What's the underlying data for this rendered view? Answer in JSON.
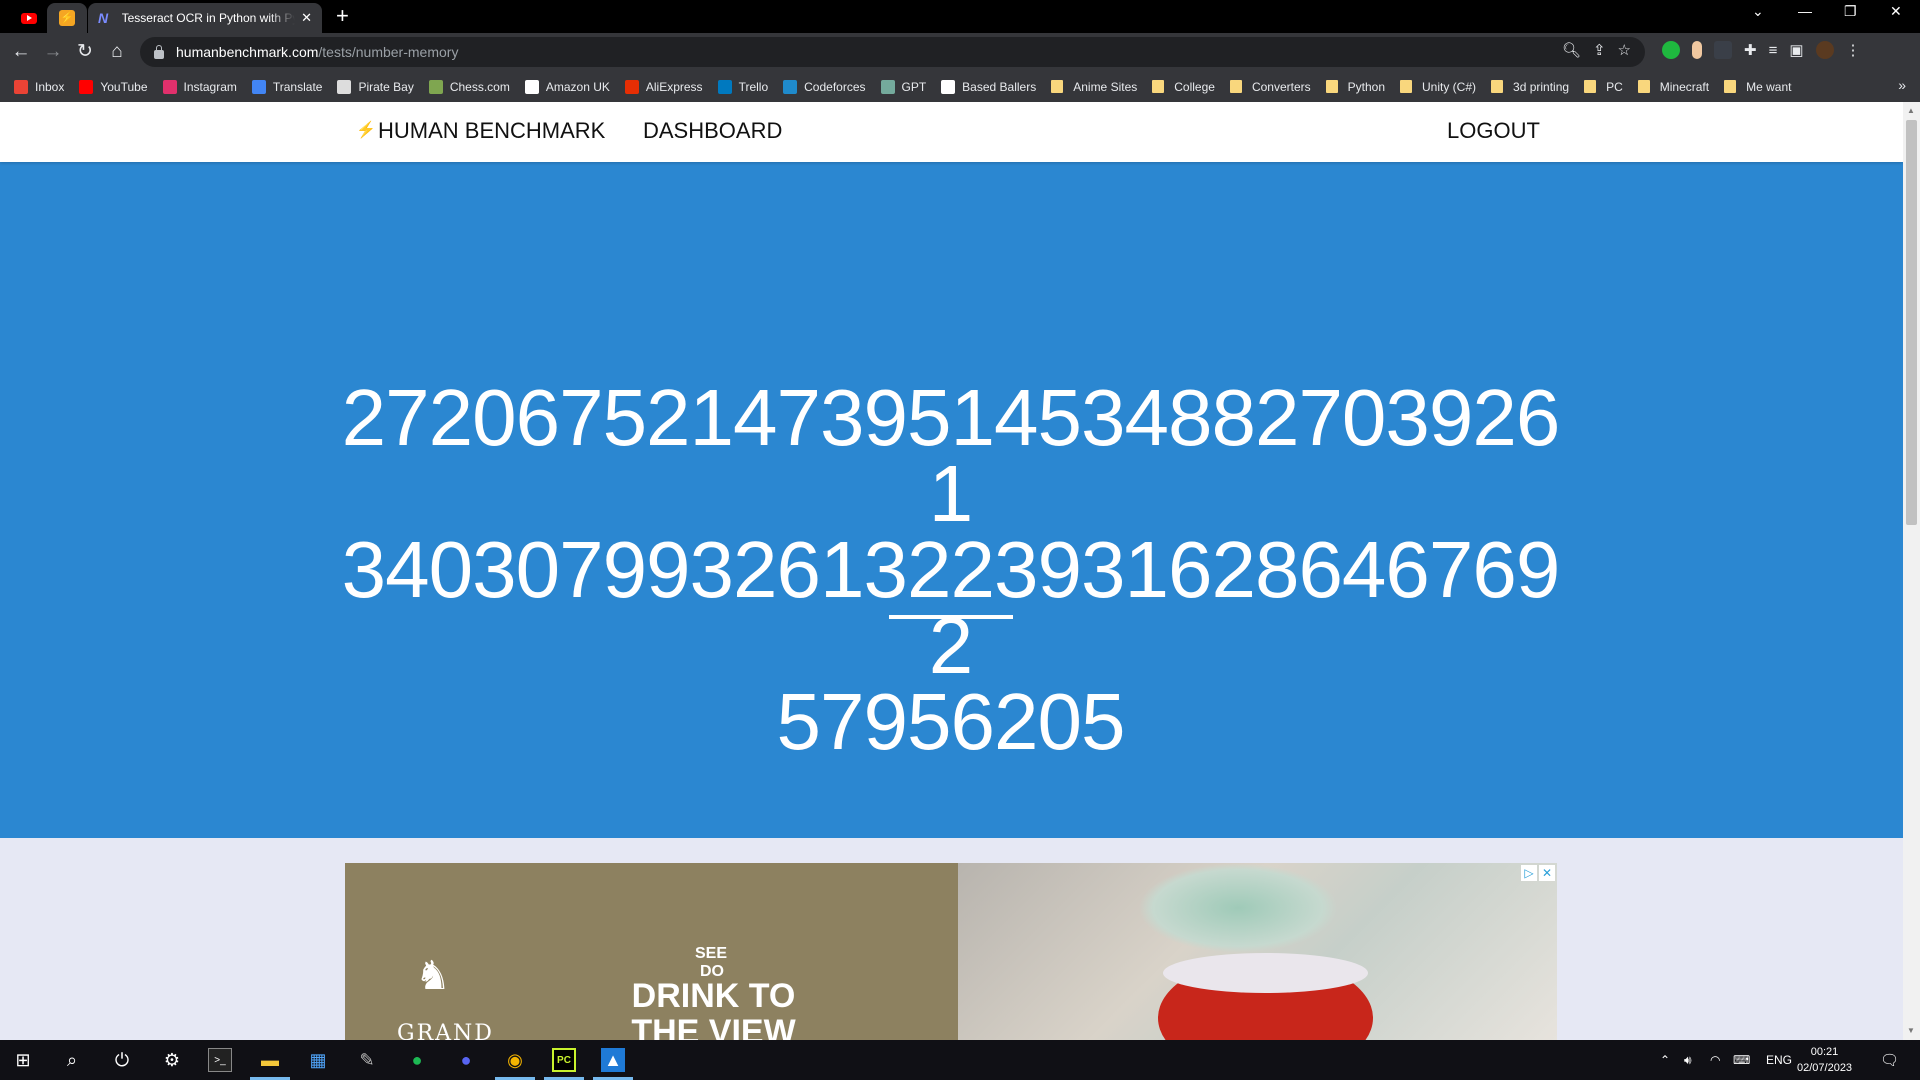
{
  "browser": {
    "tabs": [
      {
        "title": "Tesseract OCR in Python with Py",
        "active": true
      }
    ],
    "url_host": "humanbenchmark.com",
    "url_path": "/tests/number-memory",
    "bookmarks": [
      {
        "label": "Inbox",
        "icon": "gmail-icon",
        "color": "#ea4335"
      },
      {
        "label": "YouTube",
        "icon": "youtube-icon",
        "color": "#ff0000"
      },
      {
        "label": "Instagram",
        "icon": "instagram-icon",
        "color": "#e1306c"
      },
      {
        "label": "Translate",
        "icon": "translate-icon",
        "color": "#4285f4"
      },
      {
        "label": "Pirate Bay",
        "icon": "pirate-bay-icon",
        "color": "#dddddd"
      },
      {
        "label": "Chess.com",
        "icon": "chess-icon",
        "color": "#7fa650"
      },
      {
        "label": "Amazon UK",
        "icon": "amazon-icon",
        "color": "#ffffff"
      },
      {
        "label": "AliExpress",
        "icon": "aliexpress-icon",
        "color": "#e62e04"
      },
      {
        "label": "Trello",
        "icon": "trello-icon",
        "color": "#0079bf"
      },
      {
        "label": "Codeforces",
        "icon": "codeforces-icon",
        "color": "#1f8acb"
      },
      {
        "label": "GPT",
        "icon": "openai-icon",
        "color": "#74aa9c"
      },
      {
        "label": "Based Ballers",
        "icon": "based-ballers-icon",
        "color": "#ffffff"
      },
      {
        "label": "Anime Sites",
        "icon": "folder-icon",
        "folder": true
      },
      {
        "label": "College",
        "icon": "folder-icon",
        "folder": true
      },
      {
        "label": "Converters",
        "icon": "folder-icon",
        "folder": true
      },
      {
        "label": "Python",
        "icon": "folder-icon",
        "folder": true
      },
      {
        "label": "Unity (C#)",
        "icon": "folder-icon",
        "folder": true
      },
      {
        "label": "3d printing",
        "icon": "folder-icon",
        "folder": true
      },
      {
        "label": "PC",
        "icon": "folder-icon",
        "folder": true
      },
      {
        "label": "Minecraft",
        "icon": "folder-icon",
        "folder": true
      },
      {
        "label": "Me want",
        "icon": "folder-icon",
        "folder": true
      }
    ]
  },
  "nav": {
    "brand": "HUMAN BENCHMARK",
    "dashboard": "DASHBOARD",
    "logout": "LOGOUT"
  },
  "test": {
    "number": "27206752147395145348827039261340307993261322393162864676925795620 5"
  },
  "ad": {
    "see": "SEE",
    "do": "DO",
    "headline": "DRINK TO THE VIEW",
    "brand": "GRAND"
  },
  "taskbar": {
    "language": "ENG",
    "time": "00:21",
    "date": "02/07/2023"
  },
  "colors": {
    "hero": "#2b87d1",
    "chrome_dark": "#35363a"
  }
}
